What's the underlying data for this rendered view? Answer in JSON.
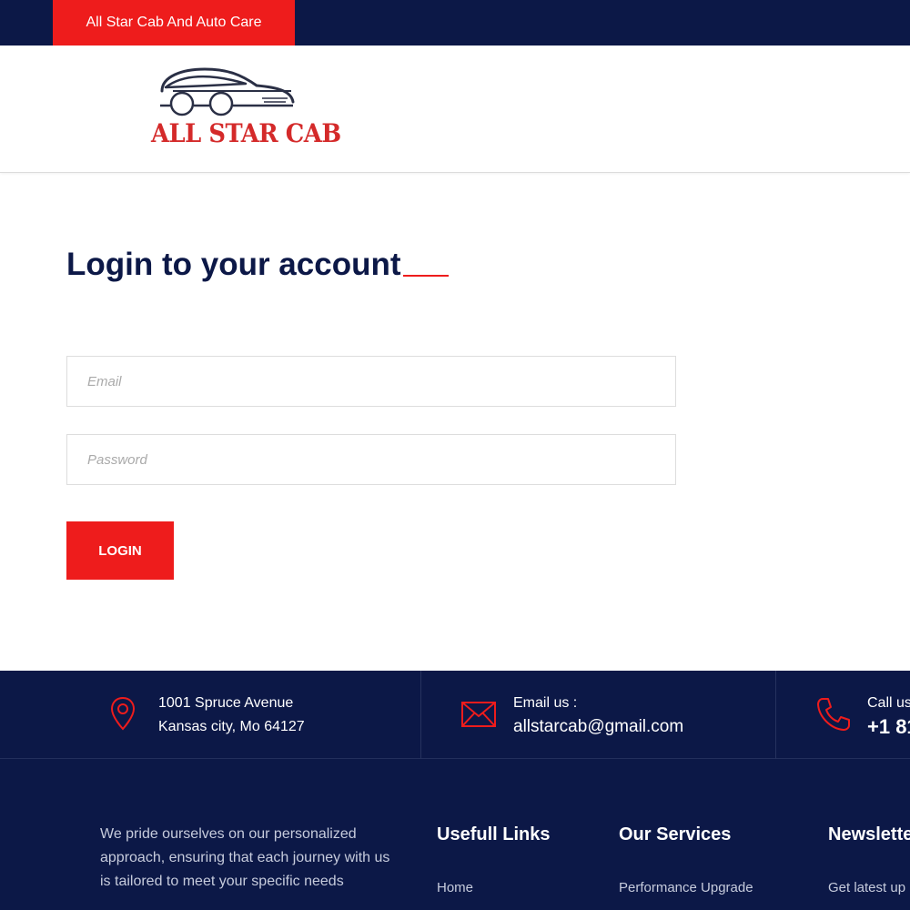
{
  "topbar": {
    "brand_label": "All Star Cab And Auto Care"
  },
  "header": {
    "logo_text": "ALL STAR CAB",
    "logo_icon": "car-icon"
  },
  "login": {
    "title": "Login to your account",
    "email_placeholder": "Email",
    "password_placeholder": "Password",
    "button_label": "LOGIN"
  },
  "contact": {
    "address_line1": "1001 Spruce Avenue",
    "address_line2": "Kansas city, Mo 64127",
    "email_label": "Email us :",
    "email_value": "allstarcab@gmail.com",
    "call_label": "Call us",
    "call_value": "+1 81"
  },
  "footer": {
    "about_text": "We pride ourselves on our personalized approach, ensuring that each journey with us is tailored to meet your specific needs",
    "links_heading": "Usefull Links",
    "links": [
      "Home"
    ],
    "services_heading": "Our Services",
    "services": [
      "Performance Upgrade"
    ],
    "newsletter_heading": "Newslette",
    "newsletter_text": "Get latest up"
  },
  "colors": {
    "navy": "#0c1847",
    "accent_red": "#ee1c1c",
    "muted_text": "#c6cbdc"
  }
}
